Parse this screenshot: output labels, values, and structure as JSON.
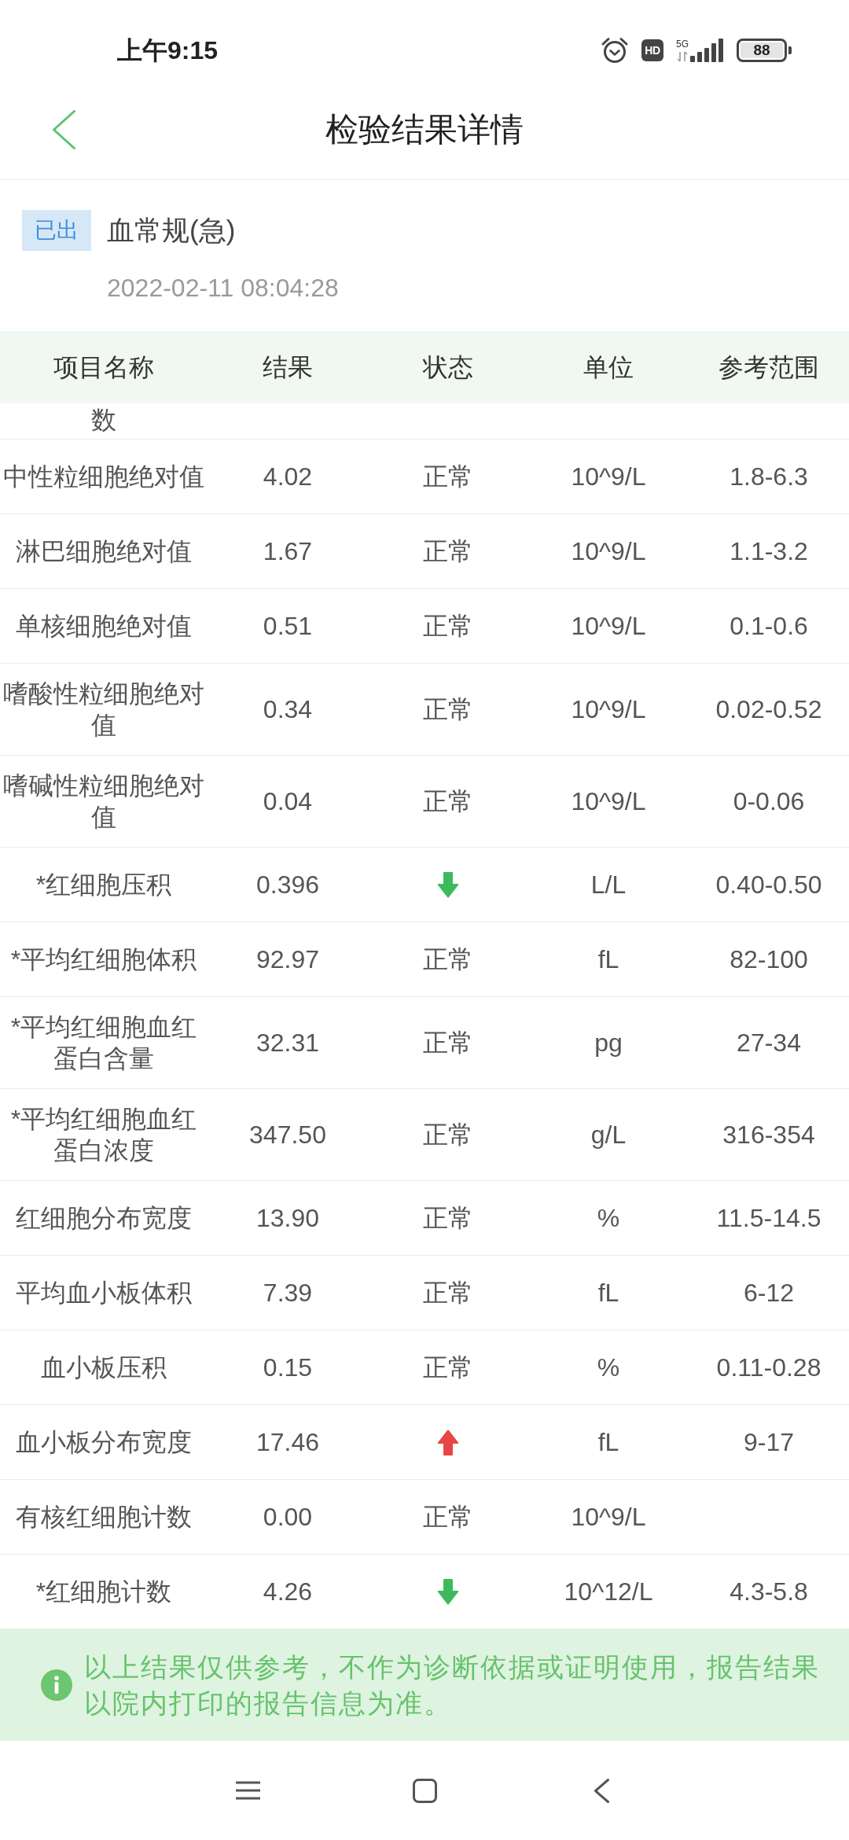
{
  "status_bar": {
    "time": "上午9:15",
    "hd": "HD",
    "network": "5G",
    "battery": "88"
  },
  "header": {
    "title": "检验结果详情"
  },
  "report": {
    "tag": "已出",
    "name": "血常规(急)",
    "datetime": "2022-02-11 08:04:28"
  },
  "table": {
    "columns": [
      "项目名称",
      "结果",
      "状态",
      "单位",
      "参考范围"
    ],
    "clipped_row": {
      "name": "数"
    },
    "rows": [
      {
        "name": "中性粒细胞绝对值",
        "result": "4.02",
        "kind": "normal",
        "status": "正常",
        "unit": "10^9/L",
        "range": "1.8-6.3"
      },
      {
        "name": "淋巴细胞绝对值",
        "result": "1.67",
        "kind": "normal",
        "status": "正常",
        "unit": "10^9/L",
        "range": "1.1-3.2"
      },
      {
        "name": "单核细胞绝对值",
        "result": "0.51",
        "kind": "normal",
        "status": "正常",
        "unit": "10^9/L",
        "range": "0.1-0.6"
      },
      {
        "name": "嗜酸性粒细胞绝对值",
        "result": "0.34",
        "kind": "normal",
        "status": "正常",
        "unit": "10^9/L",
        "range": "0.02-0.52"
      },
      {
        "name": "嗜碱性粒细胞绝对值",
        "result": "0.04",
        "kind": "normal",
        "status": "正常",
        "unit": "10^9/L",
        "range": "0-0.06"
      },
      {
        "name": "*红细胞压积",
        "result": "0.396",
        "kind": "low",
        "unit": "L/L",
        "range": "0.40-0.50"
      },
      {
        "name": "*平均红细胞体积",
        "result": "92.97",
        "kind": "normal",
        "status": "正常",
        "unit": "fL",
        "range": "82-100"
      },
      {
        "name": "*平均红细胞血红蛋白含量",
        "result": "32.31",
        "kind": "normal",
        "status": "正常",
        "unit": "pg",
        "range": "27-34"
      },
      {
        "name": "*平均红细胞血红蛋白浓度",
        "result": "347.50",
        "kind": "normal",
        "status": "正常",
        "unit": "g/L",
        "range": "316-354"
      },
      {
        "name": "红细胞分布宽度",
        "result": "13.90",
        "kind": "normal",
        "status": "正常",
        "unit": "%",
        "range": "11.5-14.5"
      },
      {
        "name": "平均血小板体积",
        "result": "7.39",
        "kind": "normal",
        "status": "正常",
        "unit": "fL",
        "range": "6-12"
      },
      {
        "name": "血小板压积",
        "result": "0.15",
        "kind": "normal",
        "status": "正常",
        "unit": "%",
        "range": "0.11-0.28"
      },
      {
        "name": "血小板分布宽度",
        "result": "17.46",
        "kind": "high",
        "unit": "fL",
        "range": "9-17"
      },
      {
        "name": "有核红细胞计数",
        "result": "0.00",
        "kind": "normal",
        "status": "正常",
        "unit": "10^9/L"
      },
      {
        "name": "*红细胞计数",
        "result": "4.26",
        "kind": "low",
        "unit": "10^12/L",
        "range": "4.3-5.8"
      }
    ]
  },
  "notice": {
    "text": "以上结果仅供参考，不作为诊断依据或证明使用，报告结果以院内打印的报告信息为准。"
  }
}
